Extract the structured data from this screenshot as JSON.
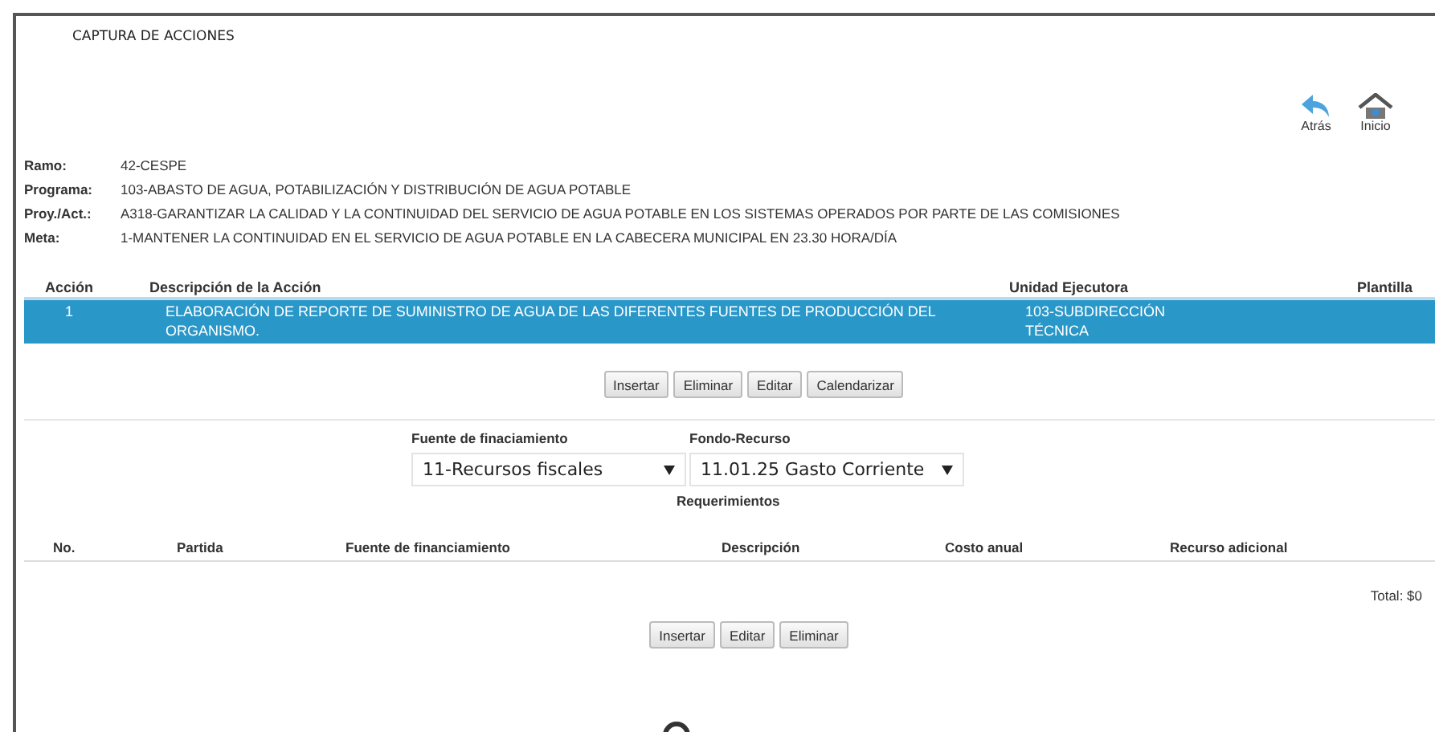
{
  "title": "CAPTURA DE ACCIONES",
  "nav": [
    {
      "label": "Atrás",
      "kind": "back"
    },
    {
      "label": "Inicio",
      "kind": "home"
    }
  ],
  "info": [
    {
      "label": "Ramo:",
      "value": "42-CESPE"
    },
    {
      "label": "Programa:",
      "value": "103-ABASTO DE AGUA, POTABILIZACIÓN Y DISTRIBUCIÓN DE AGUA POTABLE"
    },
    {
      "label": "Proy./Act.:",
      "value": "A318-GARANTIZAR LA CALIDAD Y LA CONTINUIDAD DEL SERVICIO DE AGUA POTABLE EN LOS SISTEMAS OPERADOS POR PARTE DE LAS COMISIONES"
    },
    {
      "label": "Meta:",
      "value": "1-MANTENER LA CONTINUIDAD EN EL SERVICIO DE AGUA POTABLE EN LA CABECERA MUNICIPAL EN 23.30 HORA/DÍA"
    }
  ],
  "actions_table": {
    "columns": [
      "Acción",
      "Descripción de la Acción",
      "Unidad Ejecutora",
      "Plantilla"
    ],
    "rows": [
      {
        "cells": [
          "1",
          "ELABORACIÓN DE REPORTE DE SUMINISTRO DE AGUA DE LAS DIFERENTES FUENTES DE PRODUCCIÓN DEL ORGANISMO.",
          "103-SUBDIRECCIÓN TÉCNICA"
        ],
        "selected": true
      }
    ]
  },
  "action_buttons": [
    "Insertar",
    "Eliminar",
    "Editar",
    "Calendarizar"
  ],
  "filters": [
    {
      "label": "Fuente de finaciamiento",
      "value": "11-Recursos fiscales"
    },
    {
      "label": "Fondo-Recurso",
      "value": "11.01.25 Gasto Corriente"
    }
  ],
  "requirements": {
    "title": "Requerimientos",
    "columns": [
      "No.",
      "Partida",
      "Fuente de financiamiento",
      "Descripción",
      "Costo anual",
      "Recurso adicional"
    ],
    "total": "Total: $0"
  },
  "requirement_buttons": [
    "Insertar",
    "Editar",
    "Eliminar"
  ]
}
